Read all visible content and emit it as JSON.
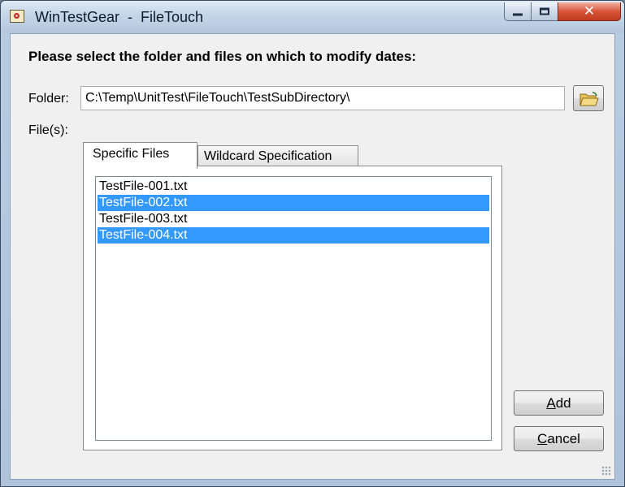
{
  "window": {
    "title": "WinTestGear  -  FileTouch",
    "controls": {
      "close_glyph": "✕"
    }
  },
  "dialog": {
    "heading": "Please select the folder and files on which to modify dates:",
    "folder_label": "Folder:",
    "folder_value": "C:\\Temp\\UnitTest\\FileTouch\\TestSubDirectory\\",
    "files_label": "File(s):",
    "tabs": [
      {
        "label": "Specific Files",
        "active": true
      },
      {
        "label": "Wildcard Specification",
        "active": false
      }
    ],
    "files": [
      {
        "name": "TestFile-001.txt",
        "selected": false
      },
      {
        "name": "TestFile-002.txt",
        "selected": true
      },
      {
        "name": "TestFile-003.txt",
        "selected": false
      },
      {
        "name": "TestFile-004.txt",
        "selected": true
      }
    ],
    "add_button": {
      "mnemonic": "A",
      "rest": "dd"
    },
    "cancel_button": {
      "mnemonic": "C",
      "rest": "ancel"
    }
  },
  "colors": {
    "selection": "#3399ff",
    "close_button": "#c13a1e",
    "title_bar": "#c4d5e8"
  },
  "icons": {
    "browse": "open-folder-icon",
    "app": "app-icon"
  }
}
